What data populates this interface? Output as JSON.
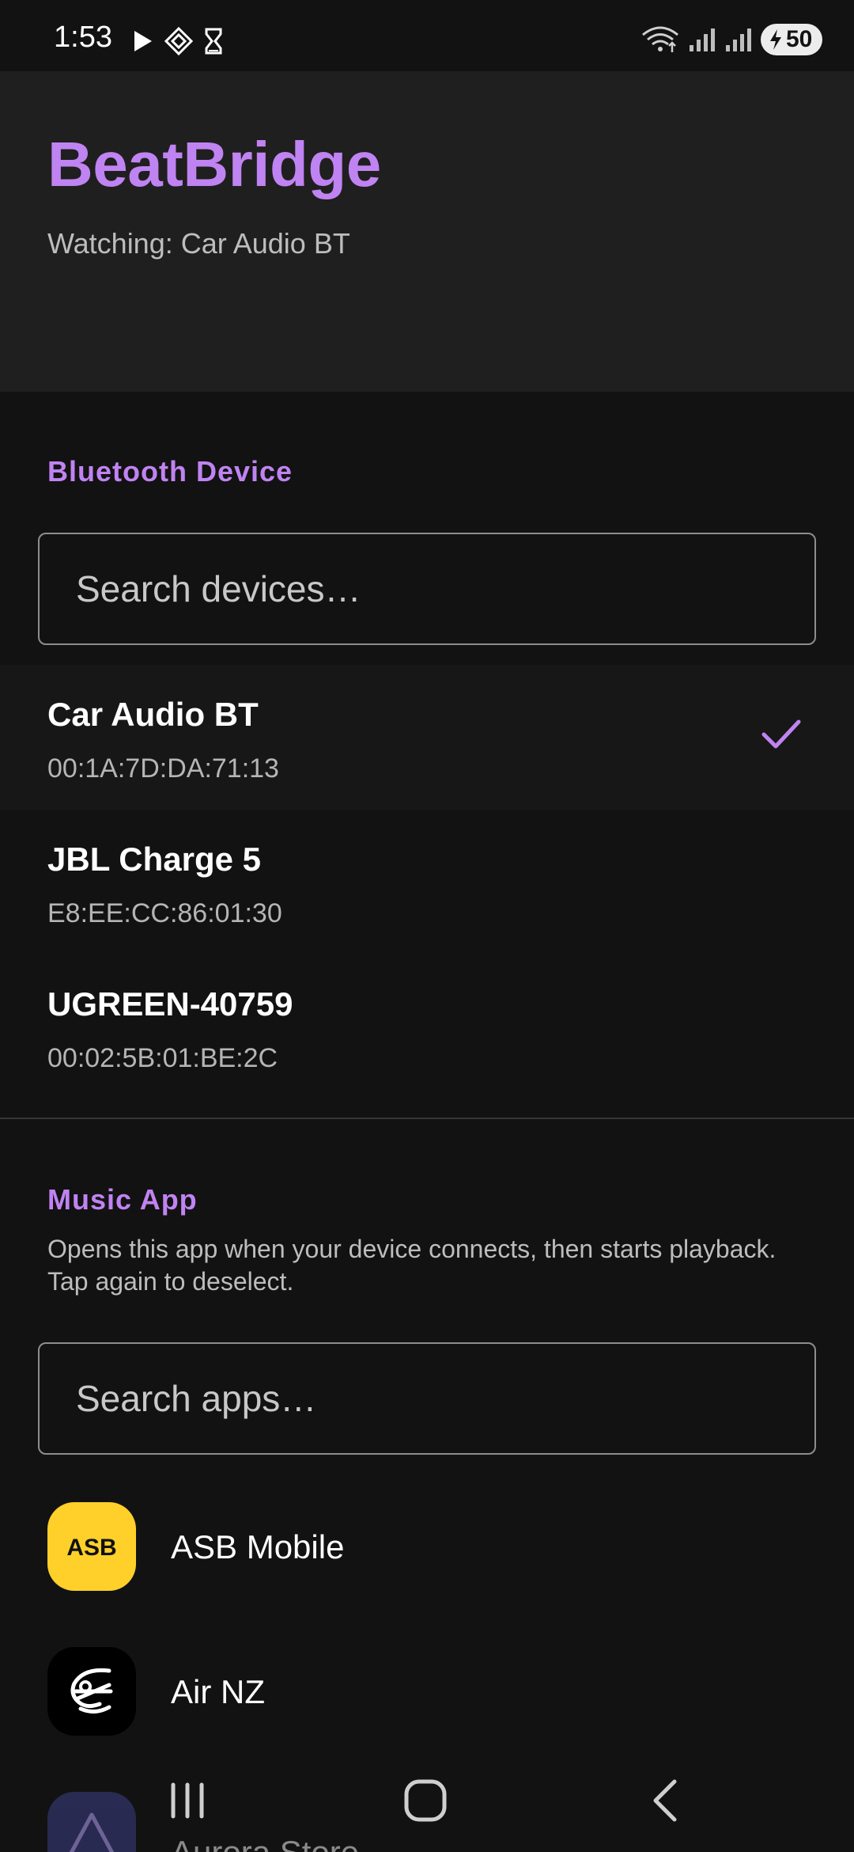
{
  "status_bar": {
    "time": "1:53",
    "battery": "50",
    "left_icons": [
      "play-icon",
      "diamond-icon",
      "hourglass-icon"
    ],
    "right_icons": [
      "wifi-icon",
      "signal-icon",
      "signal-icon",
      "battery-icon"
    ]
  },
  "header": {
    "title": "BeatBridge",
    "watching": "Watching: Car Audio BT"
  },
  "bluetooth": {
    "section_title": "Bluetooth Device",
    "search_placeholder": "Search devices…",
    "devices": [
      {
        "name": "Car Audio BT",
        "mac": "00:1A:7D:DA:71:13",
        "selected": true
      },
      {
        "name": "JBL Charge 5",
        "mac": "E8:EE:CC:86:01:30",
        "selected": false
      },
      {
        "name": "UGREEN-40759",
        "mac": "00:02:5B:01:BE:2C",
        "selected": false
      }
    ]
  },
  "music": {
    "section_title": "Music App",
    "description": "Opens this app when your device connects, then starts playback. Tap again to deselect.",
    "search_placeholder": "Search apps…",
    "apps": [
      {
        "name": "ASB Mobile",
        "icon_text": "ASB"
      },
      {
        "name": "Air NZ"
      },
      {
        "name": "Aurora Store"
      }
    ]
  },
  "colors": {
    "accent": "#c083f2",
    "background": "#121212",
    "header_background": "#1f1f1f",
    "asb_yellow": "#ffd02a"
  },
  "nav_bar": {
    "icons": [
      "recents-icon",
      "home-icon",
      "back-icon"
    ]
  }
}
